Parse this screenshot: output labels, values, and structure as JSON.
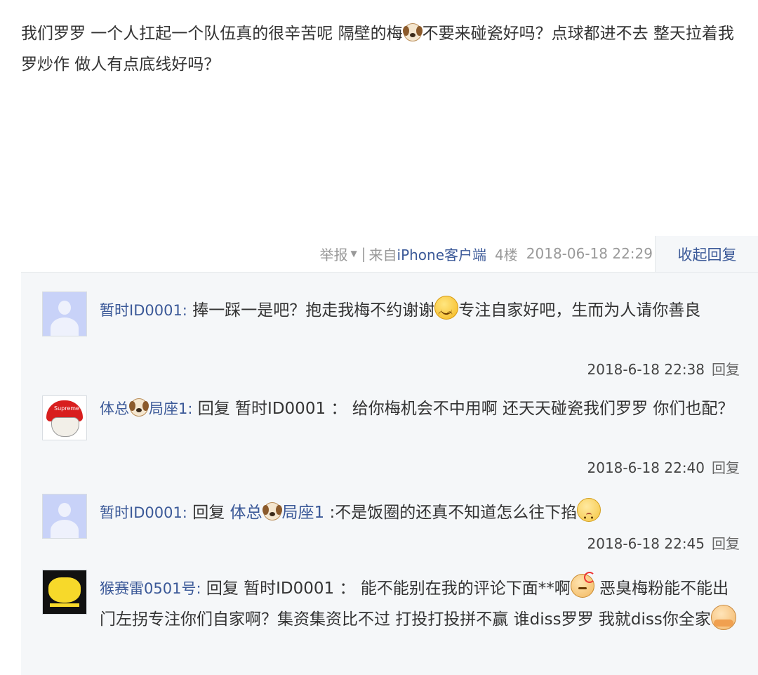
{
  "post": {
    "text_part1": "我们罗罗 一个人扛起一个队伍真的很辛苦呢 隔壁的梅",
    "text_part2": "不要来碰瓷好吗？点球都进不去 整天拉着我罗炒作 做人有点底线好吗？"
  },
  "meta": {
    "report": "举报",
    "separator": "|",
    "from_prefix": "来自",
    "client": "iPhone客户端",
    "floor": "4楼",
    "time": "2018-06-18 22:29",
    "collapse": "收起回复"
  },
  "replies": [
    {
      "user": "暂时ID0001:",
      "text_a": " 捧一踩一是吧？抱走我梅不约谢谢",
      "text_b": "专注自家好吧，生而为人请你善良",
      "time": "2018-6-18 22:38",
      "reply_label": "回复"
    },
    {
      "user_a": "体总",
      "user_b": "局座1:",
      "text_a": " 回复 暂时ID0001 ： 给你梅机会不中用啊 还天天碰瓷我们罗罗 你们也配？",
      "time": "2018-6-18 22:40",
      "reply_label": "回复",
      "avatar_text": "Supreme"
    },
    {
      "user": "暂时ID0001:",
      "text_a": " 回复 ",
      "mention_a": "体总",
      "mention_b": "局座1",
      "text_b": " :不是饭圈的还真不知道怎么往下掐",
      "time": "2018-6-18 22:45",
      "reply_label": "回复"
    },
    {
      "user": "猴赛雷0501号:",
      "text_a": " 回复 暂时ID0001 ： 能不能别在我的评论下面**啊",
      "text_b": " 恶臭梅粉能不能出门左拐专注你们自家啊？集资集资比不过 打投打投拼不赢 谁diss罗罗 我就diss你全家",
      "time": "",
      "reply_label": ""
    }
  ],
  "icons": {
    "dog": "dog-emoji-icon",
    "smile": "smile-emoji-icon",
    "shy": "shy-emoji-icon",
    "angry": "angry-emoji-icon",
    "hug": "hug-emoji-icon"
  },
  "colors": {
    "link": "#3b5998",
    "meta": "#999999",
    "panel_bg": "#f5f7f9"
  }
}
